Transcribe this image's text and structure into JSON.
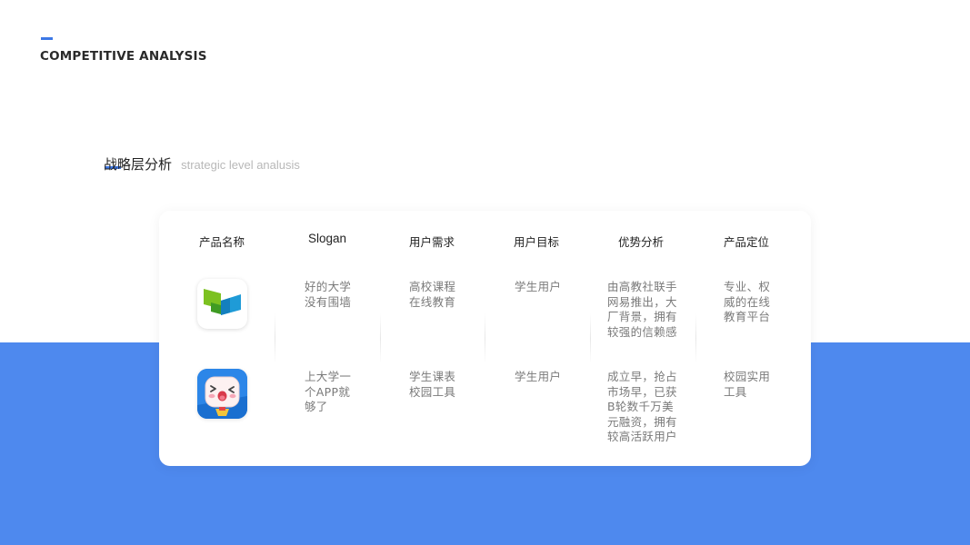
{
  "header": {
    "title": "COMPETITIVE ANALYSIS"
  },
  "section": {
    "title_cn": "战略层分析",
    "title_en": "strategic level analusis"
  },
  "table": {
    "headers": [
      "产品名称",
      "Slogan",
      "用户需求",
      "用户目标",
      "优势分析",
      "产品定位"
    ],
    "rows": [
      {
        "icon": "icourse-book-logo-icon",
        "slogan": "好的大学\n没有围墙",
        "need": "高校课程\n在线教育",
        "goal": "学生用户",
        "advantage": "由高教社联手\n网易推出，大\n厂背景，拥有\n较强的信赖感",
        "positioning": "专业、权\n威的在线\n教育平台"
      },
      {
        "icon": "cartoon-mascot-logo-icon",
        "slogan": "上大学一\n个APP就\n够了",
        "need": "学生课表\n校园工具",
        "goal": "学生用户",
        "advantage": "成立早，抢占\n市场早，已获\nB轮数千万美\n元融资，拥有\n较高活跃用户",
        "positioning": "校园实用\n工具"
      }
    ]
  },
  "colors": {
    "accent": "#3d78e6",
    "blue_band": "#4e89ee",
    "text_dark": "#222222",
    "text_muted": "#7a7a7a"
  }
}
